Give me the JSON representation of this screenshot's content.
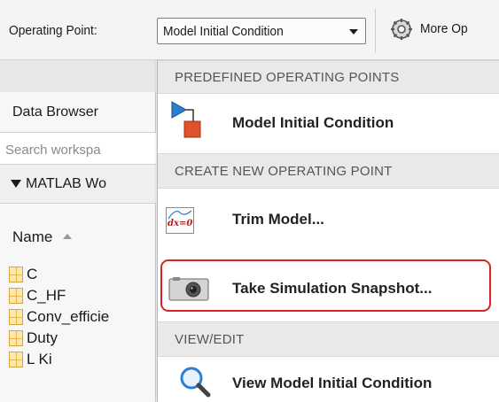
{
  "toolbar": {
    "operating_point_label": "Operating Point:",
    "operating_point_value": "Model Initial Condition",
    "more_options_label": "More Op"
  },
  "left_panel": {
    "title": "Data Browser",
    "search_placeholder": "Search workspa",
    "workspace_label": "MATLAB Wo",
    "column_header": "Name",
    "variables": [
      "C",
      "C_HF",
      "Conv_efficie",
      "Duty",
      "L Ki"
    ]
  },
  "dropdown": {
    "section_predefined": "PREDEFINED OPERATING POINTS",
    "item_model_initial": "Model Initial Condition",
    "section_create": "CREATE NEW OPERATING POINT",
    "item_trim": "Trim Model...",
    "trim_icon_text": "dx=0",
    "item_snapshot": "Take Simulation Snapshot...",
    "section_view": "VIEW/EDIT",
    "item_view_initial": "View Model Initial Condition"
  },
  "icons": {
    "more_options": "gear-icon",
    "model_initial": "model-block-icon",
    "trim": "trim-model-icon",
    "snapshot": "camera-icon",
    "view": "magnifier-icon"
  },
  "colors": {
    "highlight": "#e02020",
    "block_blue": "#2a7fd0",
    "block_red": "#e0522a",
    "variable_icon": "#e8b84a"
  }
}
